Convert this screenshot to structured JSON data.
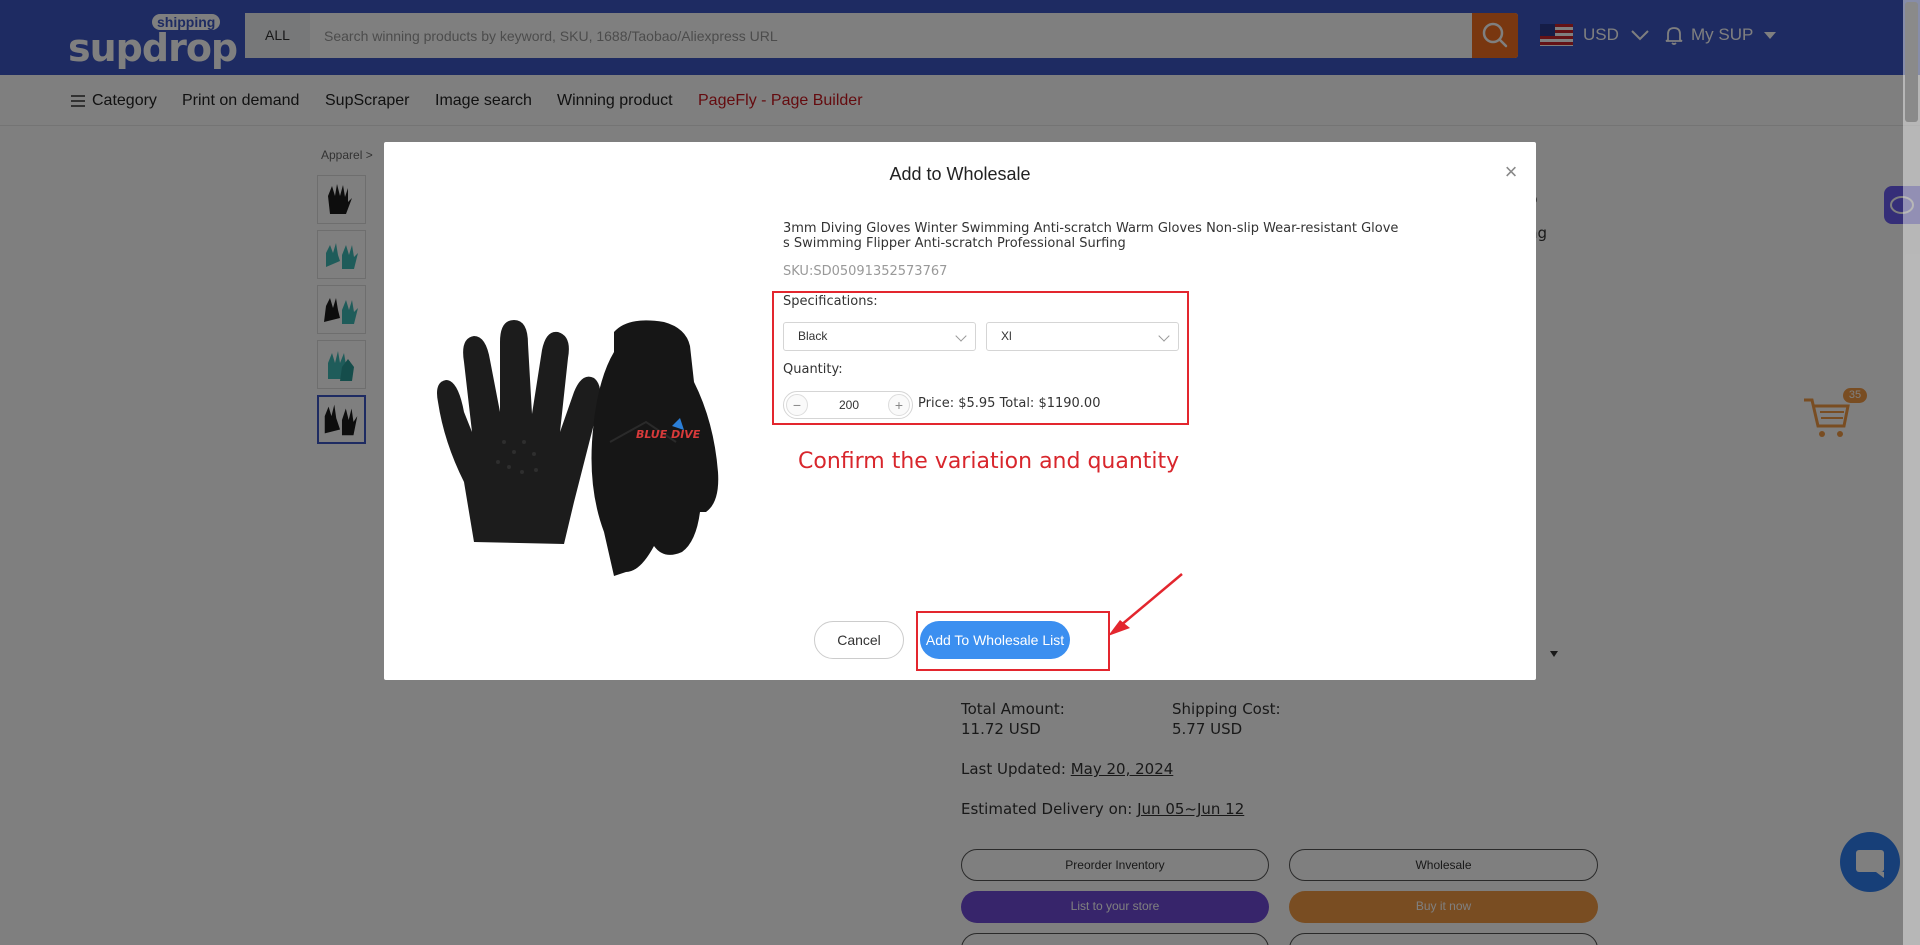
{
  "header": {
    "logo_main": "supdrop",
    "logo_tag": "shipping",
    "search_scope": "ALL",
    "search_placeholder": "Search winning products by keyword, SKU, 1688/Taobao/Aliexpress URL",
    "currency": "USD",
    "account_label": "My SUP"
  },
  "nav": {
    "items": [
      "Category",
      "Print on demand",
      "SupScraper",
      "Image search",
      "Winning product",
      "PageFly - Page Builder"
    ]
  },
  "background": {
    "breadcrumb": "Apparel",
    "text_right_1": "p",
    "text_right_2": "ng",
    "total_amount_label": "Total Amount:",
    "total_amount_value": "11.72 USD",
    "shipping_cost_label": "Shipping Cost:",
    "shipping_cost_value": "5.77 USD",
    "last_updated_label": "Last Updated:",
    "last_updated_value": "May 20, 2024",
    "delivery_label": "Estimated Delivery on:",
    "delivery_value": "Jun 05~Jun 12",
    "buttons": {
      "preorder": "Preorder Inventory",
      "wholesale": "Wholesale",
      "list_store": "List to your store",
      "buy_now": "Buy it now"
    },
    "cart_count": "35"
  },
  "modal": {
    "title": "Add to Wholesale",
    "close_symbol": "×",
    "product_title": "3mm Diving Gloves Winter Swimming Anti-scratch Warm Gloves Non-slip Wear-resistant Gloves Swimming Flipper Anti-scratch Professional Surfing",
    "product_brand_on_image": "BLUE DIVE",
    "sku": "SKU:SD05091352573767",
    "spec_label": "Specifications:",
    "color_value": "Black",
    "size_value": "Xl",
    "quantity_label": "Quantity:",
    "quantity_value": "200",
    "minus": "−",
    "plus": "+",
    "price_line": "Price: $5.95 Total: $1190.00",
    "annotation": "Confirm the variation and quantity",
    "cancel_label": "Cancel",
    "add_label": "Add To Wholesale List"
  },
  "colors": {
    "brand_blue": "#3d56c5",
    "accent_orange": "#f36f21",
    "primary_button": "#3b8ff0",
    "annotation_red": "#e3262e"
  }
}
